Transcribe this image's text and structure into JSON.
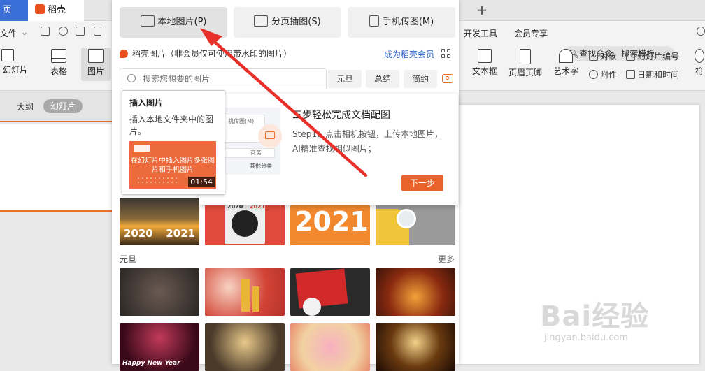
{
  "tabs": {
    "active_tab": "页",
    "daoke_tab": "稻壳",
    "plus": "+"
  },
  "menu": {
    "file": "文件",
    "dev_tools": "开发工具",
    "vip": "会员专享",
    "search_placeholder": "查找命令、搜索模板"
  },
  "ribbon": {
    "slide": "幻灯片",
    "table": "表格",
    "picture": "图片",
    "textbox": "文本框",
    "header_footer": "页眉页脚",
    "art_text": "艺术字",
    "object": "对象",
    "slide_number": "幻灯片编号",
    "attachment": "附件",
    "date_time": "日期和时间",
    "symbol": "符"
  },
  "left": {
    "outline": "大纲",
    "slides": "幻灯片"
  },
  "panel": {
    "local_picture": "本地图片(P)",
    "page_picture": "分页插图(S)",
    "phone_picture": "手机传图(M)",
    "daoke_label": "稻壳图片（非会员仅可使用带水印的图片）",
    "member_link": "成为稻壳会员",
    "search_placeholder": "搜索您想要的图片",
    "chips": [
      "元旦",
      "总结",
      "简约"
    ],
    "section_title": "元旦",
    "more": "更多"
  },
  "tooltip": {
    "title": "插入图片",
    "desc": "插入本地文件夹中的图片。",
    "video_text": "在幻灯片中插入图片多张图片和手机图片",
    "duration": "01:54"
  },
  "guide": {
    "title": "三步轻松完成文档配图",
    "text": "Step1：点击相机按钮，上传本地图片，AI精准查找相似图片；",
    "next_button": "下一步",
    "illus_label": "机传图(M)",
    "illus_item": "商务",
    "illus_category": "其他分类"
  },
  "tiles": {
    "t_a_left": "2020",
    "t_a_right": "2021",
    "t_b_left": "2020",
    "t_b_right": "2021",
    "t_c": "2021",
    "t_5": "Happy New Year"
  },
  "watermark": {
    "brand": "Bai经验",
    "url": "jingyan.baidu.com"
  },
  "colors": {
    "accent": "#e8632c",
    "link": "#2f66c9",
    "active_tab": "#3a6fd8",
    "arrow": "#e8302a"
  }
}
